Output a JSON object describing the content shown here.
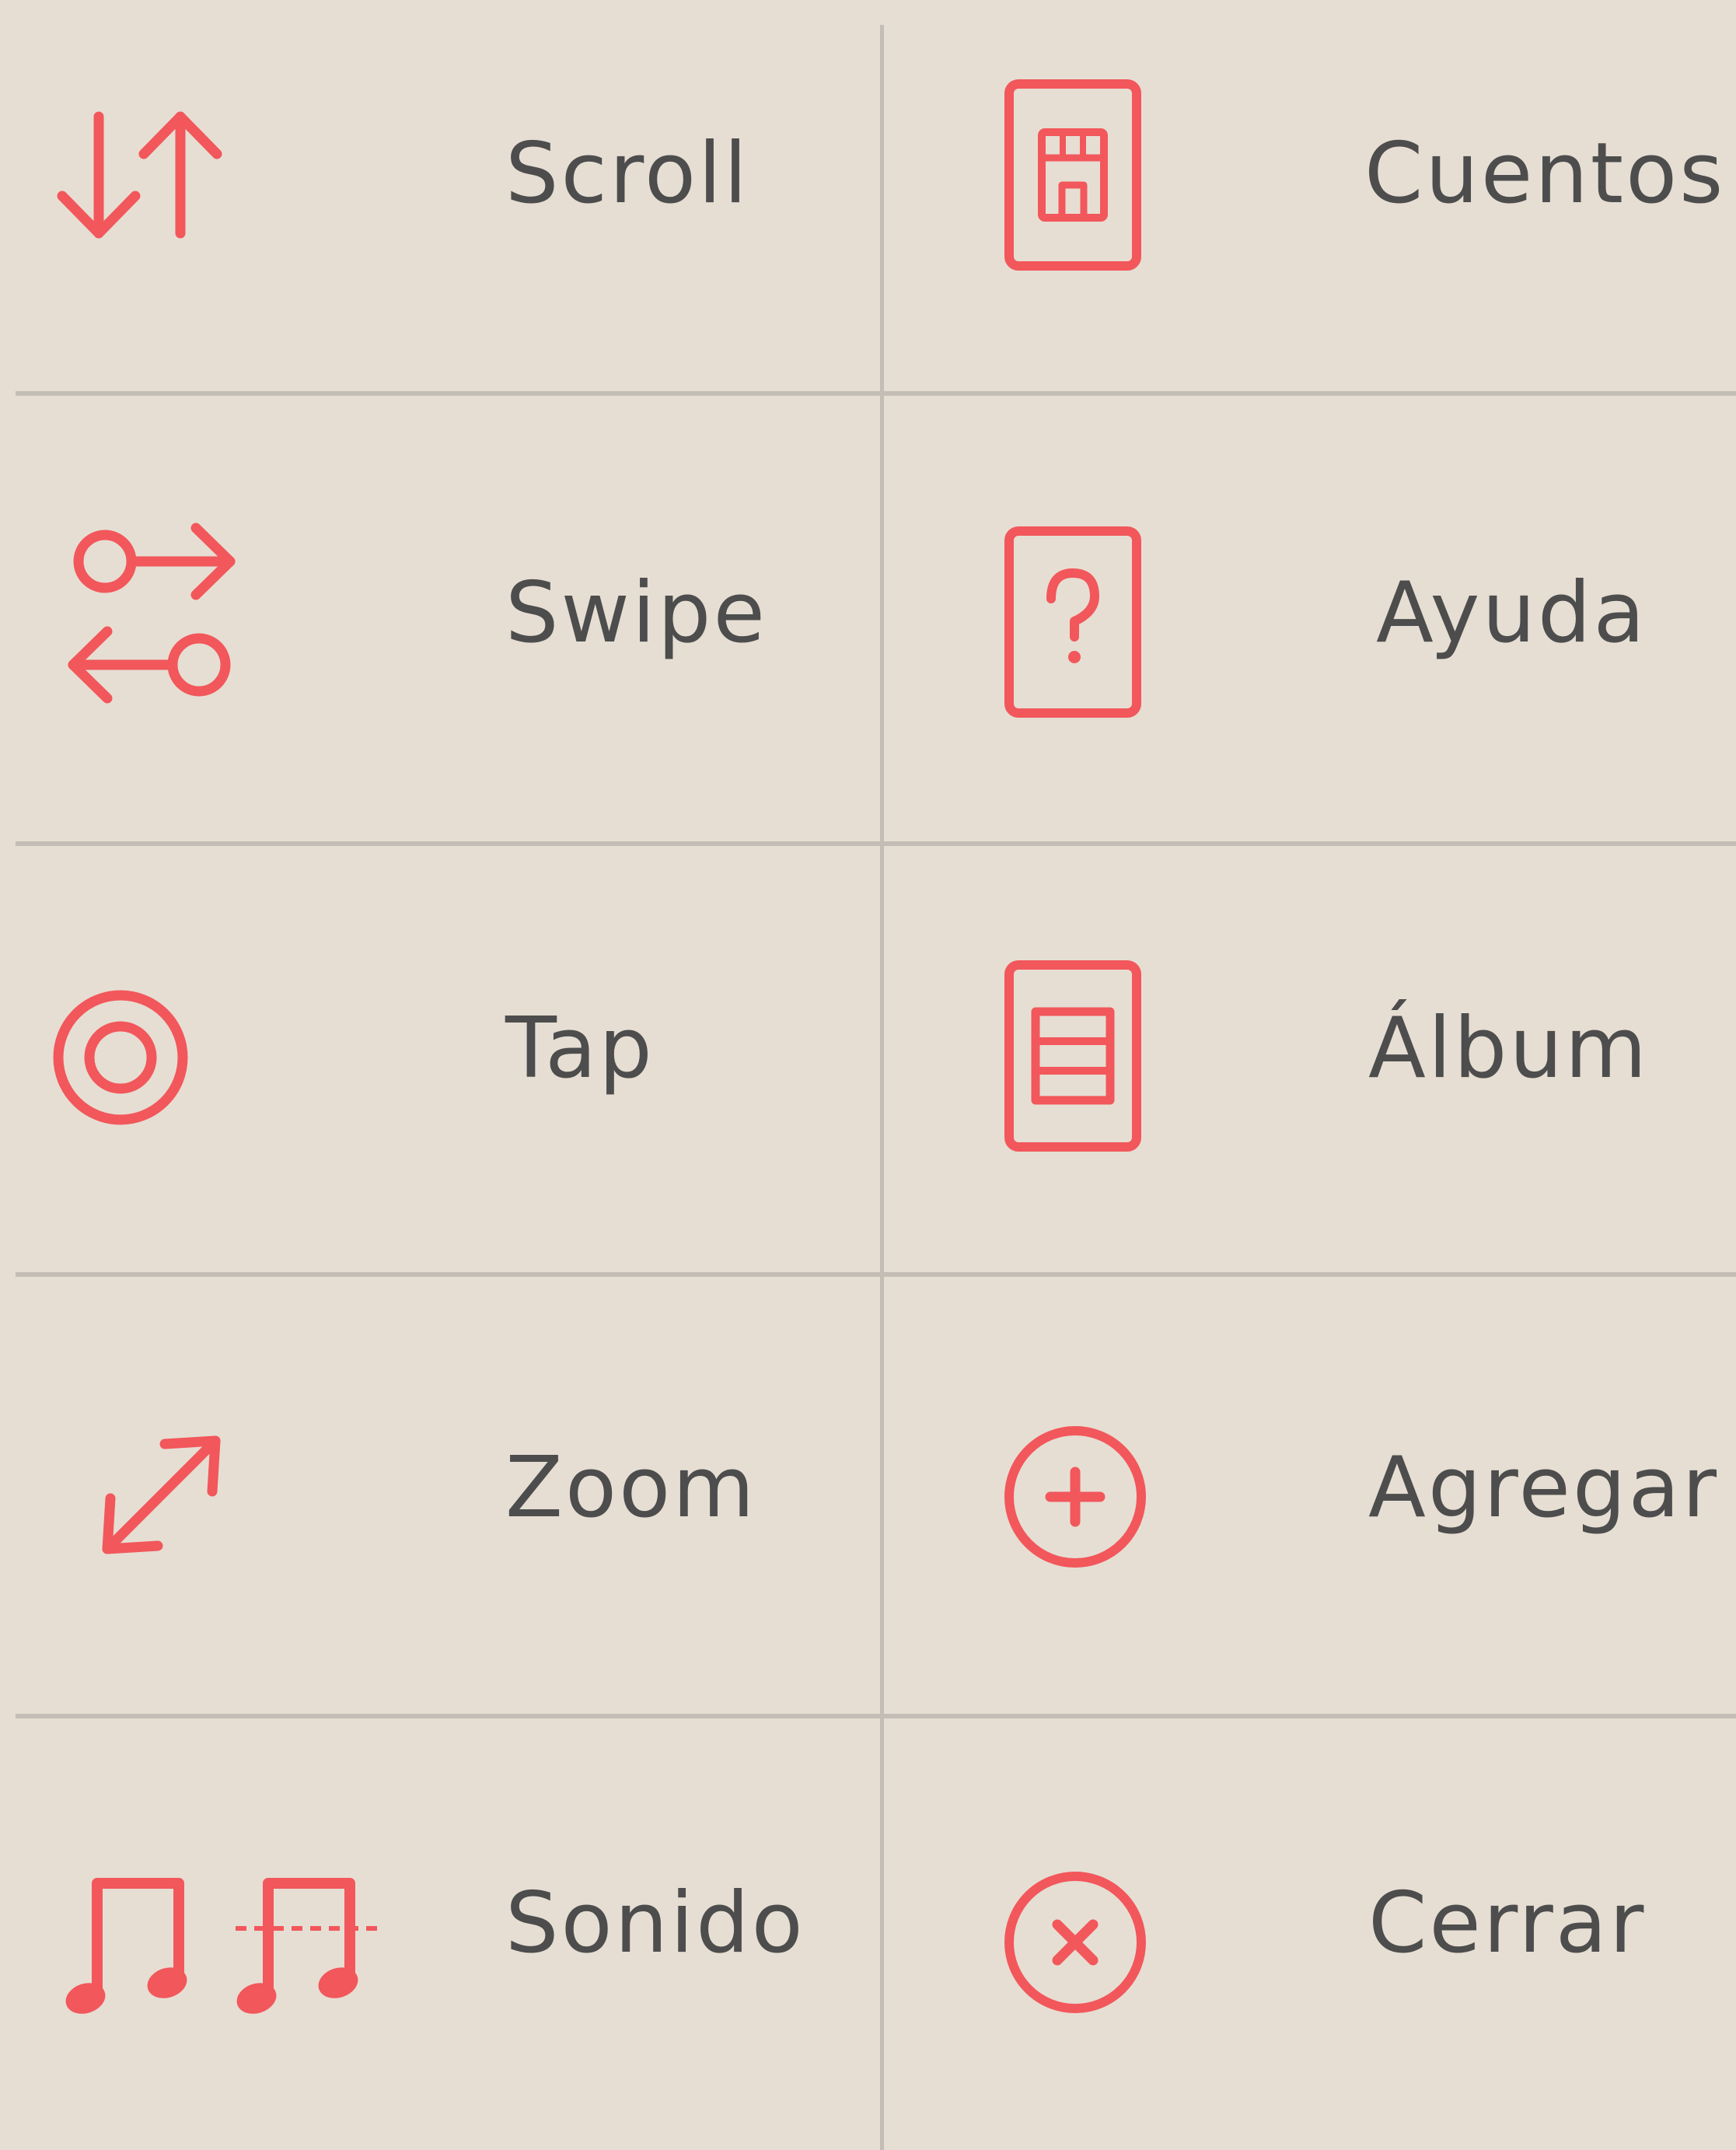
{
  "colors": {
    "background": "#e6ded3",
    "accent": "#f2575b",
    "text": "#4d4d4d",
    "divider": "#c3bdb5"
  },
  "legend": {
    "gestures": [
      {
        "label": "Scroll",
        "icon": "scroll-arrows-icon"
      },
      {
        "label": "Swipe",
        "icon": "swipe-arrows-icon"
      },
      {
        "label": "Tap",
        "icon": "tap-target-icon"
      },
      {
        "label": "Zoom",
        "icon": "zoom-diagonal-arrow-icon"
      },
      {
        "label": "Sonido",
        "icon": "music-note-icon"
      }
    ],
    "actions": [
      {
        "label": "Cuentos",
        "icon": "stories-card-icon"
      },
      {
        "label": "Ayuda",
        "icon": "help-card-icon"
      },
      {
        "label": "Álbum",
        "icon": "album-card-icon"
      },
      {
        "label": "Agregar",
        "icon": "add-circle-icon"
      },
      {
        "label": "Cerrar",
        "icon": "close-circle-icon"
      }
    ]
  }
}
